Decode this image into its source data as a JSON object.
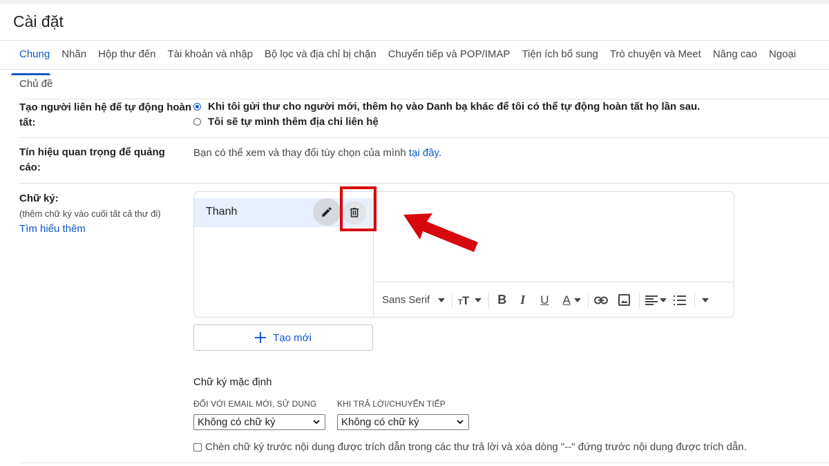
{
  "page_title": "Cài đặt",
  "tabs": [
    "Chung",
    "Nhãn",
    "Hộp thư đến",
    "Tài khoản và nhập",
    "Bộ lọc và địa chỉ bị chặn",
    "Chuyển tiếp và POP/IMAP",
    "Tiện ích bổ sung",
    "Trò chuyện và Meet",
    "Nâng cao",
    "Ngoại"
  ],
  "active_tab": "Chung",
  "subtab": "Chủ đề",
  "autocomplete": {
    "label_line1": "Tạo người liên hệ để tự động hoàn",
    "label_line2": "tất:",
    "option1": "Khi tôi gửi thư cho người mới, thêm họ vào Danh bạ khác để tôi có thể tự động hoàn tất họ lần sau.",
    "option2": "Tôi sẽ tự mình thêm địa chỉ liên hệ",
    "selected": 1
  },
  "ads": {
    "label_line1": "Tín hiệu quan trọng để quảng",
    "label_line2": "cáo:",
    "text": "Bạn có thể xem và thay đổi tùy chọn của mình ",
    "link": "tại đây",
    "text_end": "."
  },
  "signature": {
    "label": "Chữ ký:",
    "hint": "(thêm chữ ký vào cuối tất cả thư đi)",
    "learn_more": "Tìm hiểu thêm",
    "items": [
      "Thanh"
    ],
    "toolbar": {
      "font": "Sans Serif",
      "icons": [
        "size-icon",
        "bold-icon",
        "italic-icon",
        "underline-icon",
        "text-color-icon",
        "link-icon",
        "image-icon",
        "align-icon",
        "list-icon",
        "more-icon"
      ]
    },
    "create_label": "Tạo mới"
  },
  "defaults": {
    "heading": "Chữ ký mặc định",
    "new_email_caption": "ĐỐI VỚI EMAIL MỚI, SỬ DỤNG",
    "reply_caption": "KHI TRẢ LỜI/CHUYỂN TIẾP",
    "new_email_value": "Không có chữ ký",
    "reply_value": "Không có chữ ký",
    "insert_before_text": "Chèn chữ ký trước nội dung được trích dẫn trong các thư trả lời và xóa dòng \"--\" đứng trước nội dung được trích dẫn."
  },
  "colors": {
    "accent": "#0b57d0",
    "highlight": "#d6070d"
  }
}
